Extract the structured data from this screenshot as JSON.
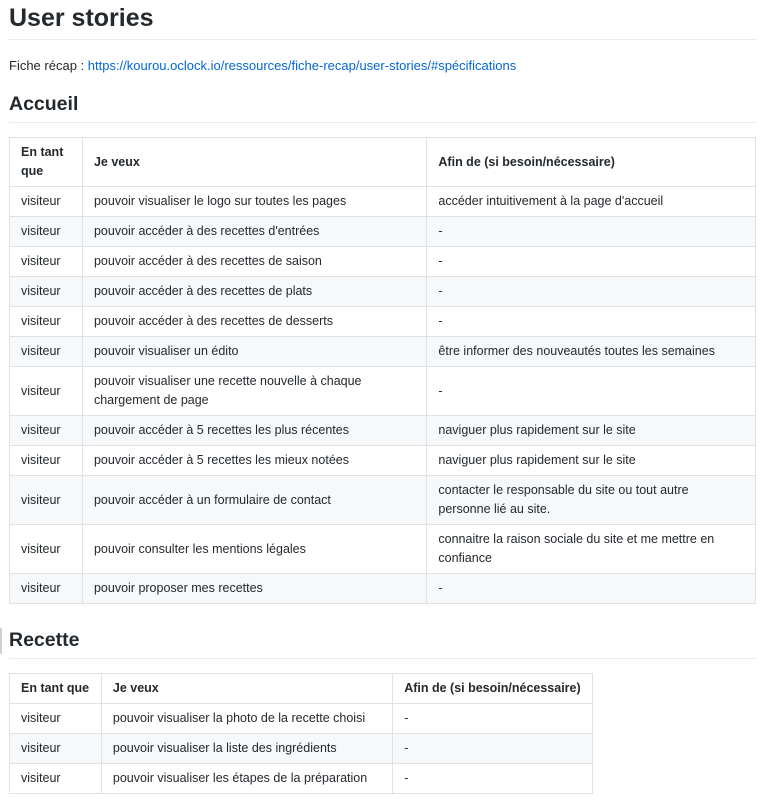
{
  "title": "User stories",
  "recap": {
    "label": "Fiche récap : ",
    "link": "https://kourou.oclock.io/ressources/fiche-recap/user-stories/#spécifications"
  },
  "sections": [
    {
      "heading": "Accueil",
      "columns": [
        "En tant que",
        "Je veux",
        "Afin de (si besoin/nécessaire)"
      ],
      "rows": [
        [
          "visiteur",
          "pouvoir visualiser le logo sur toutes les pages",
          "accéder intuitivement à la page d'accueil"
        ],
        [
          "visiteur",
          "pouvoir accéder à des recettes d'entrées",
          "-"
        ],
        [
          "visiteur",
          "pouvoir accéder à des recettes de saison",
          "-"
        ],
        [
          "visiteur",
          "pouvoir accéder à des recettes de plats",
          "-"
        ],
        [
          "visiteur",
          "pouvoir accéder à des recettes de desserts",
          "-"
        ],
        [
          "visiteur",
          "pouvoir visualiser un édito",
          "être informer des nouveautés toutes les semaines"
        ],
        [
          "visiteur",
          "pouvoir visualiser une recette nouvelle à chaque chargement de page",
          "-"
        ],
        [
          "visiteur",
          "pouvoir accéder à 5 recettes les plus récentes",
          "naviguer plus rapidement sur le site"
        ],
        [
          "visiteur",
          "pouvoir accéder à 5 recettes les mieux notées",
          "naviguer plus rapidement sur le site"
        ],
        [
          "visiteur",
          "pouvoir accéder à un formulaire de contact",
          "contacter le responsable du site ou tout autre personne lié au site."
        ],
        [
          "visiteur",
          "pouvoir consulter les mentions légales",
          "connaitre la raison sociale du site et me mettre en confiance"
        ],
        [
          "visiteur",
          "pouvoir proposer mes recettes",
          "-"
        ]
      ]
    },
    {
      "heading": "Recette",
      "columns": [
        "En tant que",
        "Je veux",
        "Afin de (si besoin/nécessaire)"
      ],
      "rows": [
        [
          "visiteur",
          "pouvoir visualiser la photo de la recette choisi",
          "-"
        ],
        [
          "visiteur",
          "pouvoir visualiser la liste des ingrédients",
          "-"
        ],
        [
          "visiteur",
          "pouvoir visualiser les étapes de la préparation",
          "-"
        ]
      ]
    }
  ]
}
